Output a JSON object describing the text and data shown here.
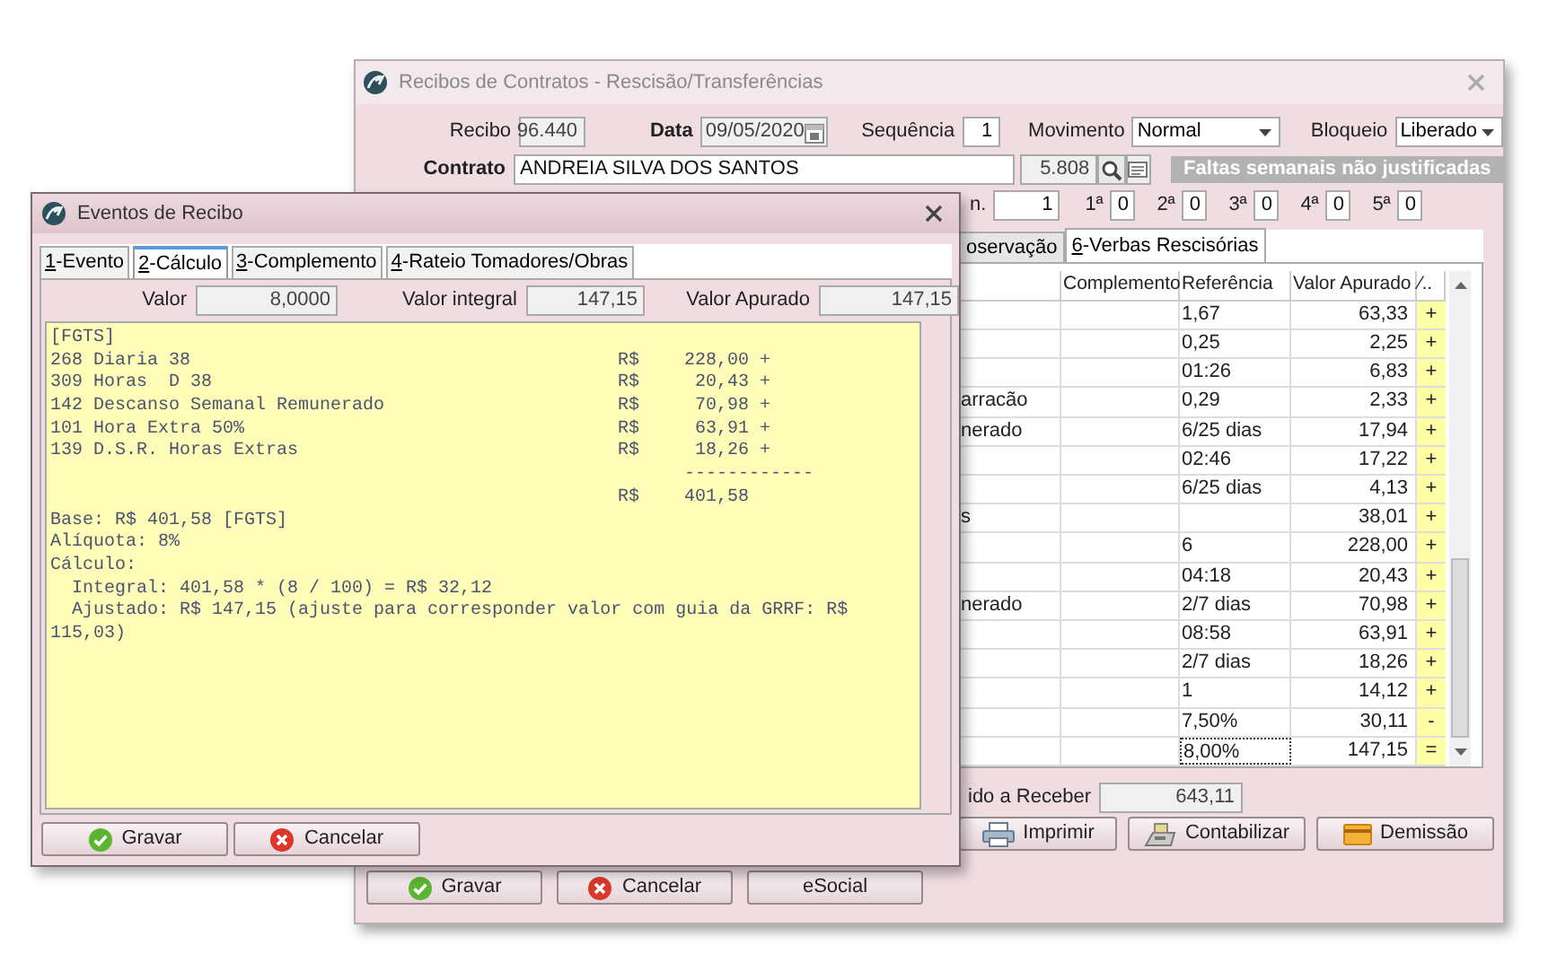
{
  "main_window": {
    "title": "Recibos de Contratos - Rescisão/Transferências",
    "recibo": {
      "label": "Recibo",
      "value": "96.440"
    },
    "data": {
      "label": "Data",
      "value": "09/05/2020"
    },
    "sequencia": {
      "label": "Sequência",
      "value": "1"
    },
    "movimento": {
      "label": "Movimento",
      "value": "Normal"
    },
    "bloqueio": {
      "label": "Bloqueio",
      "value": "Liberado"
    },
    "contrato": {
      "label": "Contrato",
      "value": "ANDREIA SILVA DOS SANTOS",
      "code": "5.808"
    },
    "faltas_banner": "Faltas semanais não justificadas",
    "partial_field": {
      "label": "n.",
      "value": "1"
    },
    "weeks": [
      {
        "label": "1ª",
        "value": "0"
      },
      {
        "label": "2ª",
        "value": "0"
      },
      {
        "label": "3ª",
        "value": "0"
      },
      {
        "label": "4ª",
        "value": "0"
      },
      {
        "label": "5ª",
        "value": "0"
      }
    ],
    "tabs": [
      {
        "label": "oservação",
        "selected": false,
        "accelerator": false
      },
      {
        "label": "6-Verbas Rescisórias",
        "selected": true,
        "accelerator": true
      }
    ],
    "table": {
      "columns": [
        "Complemento",
        "Referência",
        "Valor Apurado",
        "⁄.."
      ],
      "rows": [
        {
          "referencia": "1,67",
          "valor": "63,33",
          "sign": "+",
          "selected": false
        },
        {
          "referencia": "0,25",
          "valor": "2,25",
          "sign": "+",
          "selected": false
        },
        {
          "referencia": "01:26",
          "valor": "6,83",
          "sign": "+",
          "selected": false
        },
        {
          "description": "arracão",
          "referencia": "0,29",
          "valor": "2,33",
          "sign": "+",
          "selected": false
        },
        {
          "description": "nerado",
          "referencia": "6/25 dias",
          "valor": "17,94",
          "sign": "+",
          "selected": false
        },
        {
          "referencia": "02:46",
          "valor": "17,22",
          "sign": "+",
          "selected": false
        },
        {
          "referencia": "6/25 dias",
          "valor": "4,13",
          "sign": "+",
          "selected": false
        },
        {
          "description": "s",
          "valor": "38,01",
          "sign": "+",
          "selected": false
        },
        {
          "referencia": "6",
          "valor": "228,00",
          "sign": "+",
          "selected": false
        },
        {
          "referencia": "04:18",
          "valor": "20,43",
          "sign": "+",
          "selected": false
        },
        {
          "description": "nerado",
          "referencia": "2/7 dias",
          "valor": "70,98",
          "sign": "+",
          "selected": false
        },
        {
          "referencia": "08:58",
          "valor": "63,91",
          "sign": "+",
          "selected": false
        },
        {
          "referencia": "2/7 dias",
          "valor": "18,26",
          "sign": "+",
          "selected": false
        },
        {
          "referencia": "1",
          "valor": "14,12",
          "sign": "+",
          "selected": false
        },
        {
          "referencia": "7,50%",
          "valor": "30,11",
          "sign": "-",
          "selected": false
        },
        {
          "referencia": "8,00%",
          "valor": "147,15",
          "sign": "=",
          "selected": true
        }
      ]
    },
    "liquido": {
      "label": "ido a Receber",
      "value": "643,11"
    },
    "action_buttons": [
      {
        "label": "Imprimir",
        "kind": "print"
      },
      {
        "label": "Contabilizar",
        "kind": "accounting"
      },
      {
        "label": "Demissão",
        "kind": "dismissal"
      }
    ],
    "footer_buttons": [
      {
        "label": "Gravar",
        "kind": "ok"
      },
      {
        "label": "Cancelar",
        "kind": "cancel"
      },
      {
        "label": "eSocial",
        "kind": "plain"
      }
    ]
  },
  "dialog": {
    "title": "Eventos de Recibo",
    "tabs": [
      {
        "label": "1-Evento",
        "selected": false
      },
      {
        "label": "2-Cálculo",
        "selected": true
      },
      {
        "label": "3-Complemento",
        "selected": false
      },
      {
        "label": "4-Rateio Tomadores/Obras",
        "selected": false
      }
    ],
    "fields": [
      {
        "label": "Valor",
        "value": "8,0000"
      },
      {
        "label": "Valor integral",
        "value": "147,15"
      },
      {
        "label": "Valor Apurado",
        "value": "147,15"
      }
    ],
    "memo": {
      "header": "[FGTS]",
      "entries": [
        {
          "text": "268 Diaria 38",
          "currency": "R$",
          "amount": "228,00",
          "sign": "+"
        },
        {
          "text": "309 Horas  D 38",
          "currency": "R$",
          "amount": "20,43",
          "sign": "+"
        },
        {
          "text": "142 Descanso Semanal Remunerado",
          "currency": "R$",
          "amount": "70,98",
          "sign": "+"
        },
        {
          "text": "101 Hora Extra 50%",
          "currency": "R$",
          "amount": "63,91",
          "sign": "+"
        },
        {
          "text": "139 D.S.R. Horas Extras",
          "currency": "R$",
          "amount": "18,26",
          "sign": "+"
        }
      ],
      "separator": "------------",
      "total": {
        "currency": "R$",
        "amount": "401,58"
      },
      "notes": [
        "Base: R$ 401,58 [FGTS]",
        "Alíquota: 8%",
        "Cálculo:",
        "  Integral: 401,58 * (8 / 100) = R$ 32,12",
        "  Ajustado: R$ 147,15 (ajuste para corresponder valor com guia da GRRF: R$ 115,03)"
      ]
    },
    "buttons": [
      {
        "label": "Gravar",
        "kind": "ok"
      },
      {
        "label": "Cancelar",
        "kind": "cancel"
      }
    ]
  }
}
